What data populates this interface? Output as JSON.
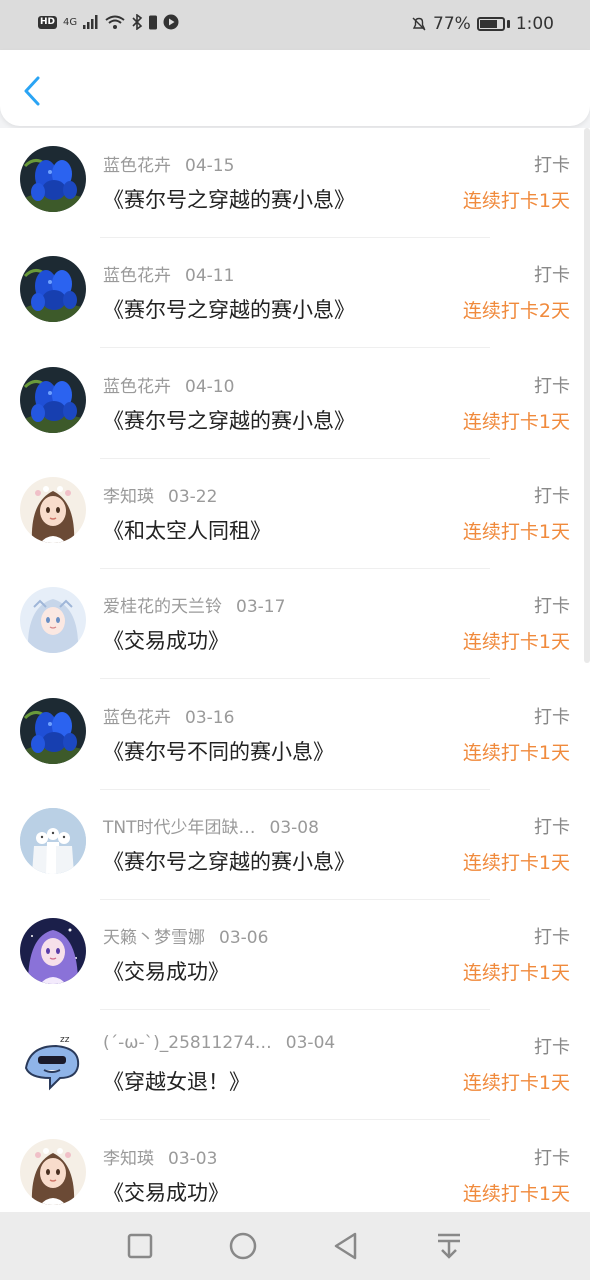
{
  "status": {
    "badge": "HD",
    "signal": "4G",
    "battery_pct": "77%",
    "time": "1:00"
  },
  "header": {
    "back_icon": "chevron-left-icon"
  },
  "colors": {
    "accent": "#2aa4f4",
    "streak": "#f08a3c",
    "meta": "#9a9a9a"
  },
  "entries": [
    {
      "user": "蓝色花卉",
      "date": "04-15",
      "book": "《赛尔号之穿越的赛小息》",
      "tag": "打卡",
      "streak": "连续打卡1天",
      "avatar": "blue-flower"
    },
    {
      "user": "蓝色花卉",
      "date": "04-11",
      "book": "《赛尔号之穿越的赛小息》",
      "tag": "打卡",
      "streak": "连续打卡2天",
      "avatar": "blue-flower"
    },
    {
      "user": "蓝色花卉",
      "date": "04-10",
      "book": "《赛尔号之穿越的赛小息》",
      "tag": "打卡",
      "streak": "连续打卡1天",
      "avatar": "blue-flower"
    },
    {
      "user": "李知瑛",
      "date": "03-22",
      "book": "《和太空人同租》",
      "tag": "打卡",
      "streak": "连续打卡1天",
      "avatar": "girl-brown"
    },
    {
      "user": "爱桂花的天兰铃",
      "date": "03-17",
      "book": "《交易成功》",
      "tag": "打卡",
      "streak": "连续打卡1天",
      "avatar": "girl-icy"
    },
    {
      "user": "蓝色花卉",
      "date": "03-16",
      "book": "《赛尔号不同的赛小息》",
      "tag": "打卡",
      "streak": "连续打卡1天",
      "avatar": "blue-flower"
    },
    {
      "user": "TNT时代少年团缺…",
      "date": "03-08",
      "book": "《赛尔号之穿越的赛小息》",
      "tag": "打卡",
      "streak": "连续打卡1天",
      "avatar": "group-white"
    },
    {
      "user": "天籁丶梦雪娜",
      "date": "03-06",
      "book": "《交易成功》",
      "tag": "打卡",
      "streak": "连续打卡1天",
      "avatar": "girl-purple"
    },
    {
      "user": "(´-ω-`)_25811274…",
      "date": "03-04",
      "book": "《穿越女退！》",
      "tag": "打卡",
      "streak": "连续打卡1天",
      "avatar": "cartoon-shark"
    },
    {
      "user": "李知瑛",
      "date": "03-03",
      "book": "《交易成功》",
      "tag": "打卡",
      "streak": "连续打卡1天",
      "avatar": "girl-brown"
    }
  ],
  "nav": [
    "recent-apps-icon",
    "home-icon",
    "back-triangle-icon",
    "notification-pull-icon"
  ]
}
